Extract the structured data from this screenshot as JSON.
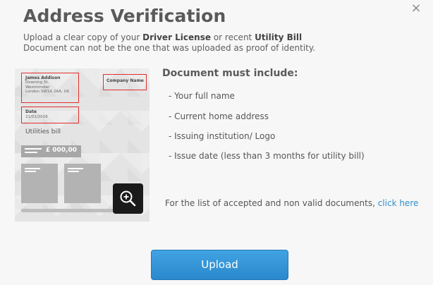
{
  "dialog": {
    "title": "Address Verification",
    "close_glyph": "×"
  },
  "intro": {
    "part1": "Upload a clear copy of your ",
    "driver_license": "Driver License",
    "part2": " or recent ",
    "utility_bill": "Utility Bill",
    "line2": "Document can not be the one that was uploaded as proof of identity."
  },
  "sample_document": {
    "name": "James Addison",
    "address_lines": [
      "Downing St.",
      "Westminster",
      "London SW1A 2AA, UK"
    ],
    "company_name": "Company Name",
    "date_label": "Date",
    "date_value": "21/01/2016",
    "doc_label": "Utilities bill",
    "amount": "£ 000,00"
  },
  "requirements": {
    "title": "Document must include:",
    "items": [
      "- Your full name",
      "- Current home address",
      "- Issuing institution/ Logo",
      "-  Issue date (less than 3 months for utility bill)"
    ]
  },
  "accepted_docs": {
    "text": "For the list of accepted and non valid documents, ",
    "link": "click here",
    "link_color": "#2d8fcd"
  },
  "actions": {
    "upload_label": "Upload",
    "upload_color": "#3399dd"
  },
  "icons": {
    "close": "close-icon",
    "zoom": "zoom-in-icon"
  }
}
